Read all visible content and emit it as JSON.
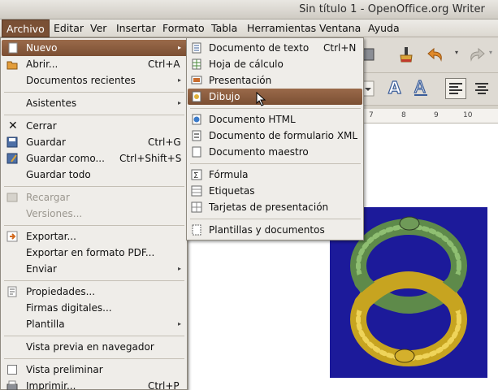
{
  "window": {
    "title": "Sin título 1 - OpenOffice.org Writer"
  },
  "menubar": {
    "items": [
      "Archivo",
      "Editar",
      "Ver",
      "Insertar",
      "Formato",
      "Tabla",
      "Herramientas",
      "Ventana",
      "Ayuda"
    ]
  },
  "archivo_menu": {
    "items": [
      {
        "label": "Nuevo",
        "shortcut": "",
        "submenu": true,
        "icon": "new-document-icon"
      },
      {
        "label": "Abrir...",
        "shortcut": "Ctrl+A",
        "icon": "open-folder-icon"
      },
      {
        "label": "Documentos recientes",
        "shortcut": "",
        "submenu": true
      },
      {
        "label": "Asistentes",
        "shortcut": "",
        "submenu": true
      },
      {
        "label": "Cerrar",
        "shortcut": "",
        "icon": "close-x-icon"
      },
      {
        "label": "Guardar",
        "shortcut": "Ctrl+G",
        "icon": "save-icon"
      },
      {
        "label": "Guardar como...",
        "shortcut": "Ctrl+Shift+S",
        "icon": "save-as-icon"
      },
      {
        "label": "Guardar todo",
        "shortcut": ""
      },
      {
        "label": "Recargar",
        "shortcut": "",
        "disabled": true,
        "icon": "reload-icon"
      },
      {
        "label": "Versiones...",
        "shortcut": "",
        "disabled": true
      },
      {
        "label": "Exportar...",
        "shortcut": "",
        "icon": "export-icon"
      },
      {
        "label": "Exportar en formato PDF...",
        "shortcut": ""
      },
      {
        "label": "Enviar",
        "shortcut": "",
        "submenu": true
      },
      {
        "label": "Propiedades...",
        "shortcut": "",
        "icon": "properties-icon"
      },
      {
        "label": "Firmas digitales...",
        "shortcut": ""
      },
      {
        "label": "Plantilla",
        "shortcut": "",
        "submenu": true
      },
      {
        "label": "Vista previa en navegador",
        "shortcut": ""
      },
      {
        "label": "Vista preliminar",
        "shortcut": "",
        "icon": "checkbox-icon"
      },
      {
        "label": "Imprimir...",
        "shortcut": "Ctrl+P",
        "icon": "print-icon"
      }
    ]
  },
  "nuevo_submenu": {
    "items": [
      {
        "label": "Documento de texto",
        "shortcut": "Ctrl+N",
        "icon": "text-document-icon"
      },
      {
        "label": "Hoja de cálculo",
        "shortcut": "",
        "icon": "spreadsheet-icon"
      },
      {
        "label": "Presentación",
        "shortcut": "",
        "icon": "presentation-icon"
      },
      {
        "label": "Dibujo",
        "shortcut": "",
        "icon": "drawing-icon"
      },
      {
        "label": "Documento HTML",
        "shortcut": "",
        "icon": "html-document-icon"
      },
      {
        "label": "Documento de formulario XML",
        "shortcut": "",
        "icon": "xml-form-icon"
      },
      {
        "label": "Documento maestro",
        "shortcut": "",
        "icon": "master-document-icon"
      },
      {
        "label": "Fórmula",
        "shortcut": "",
        "icon": "formula-icon"
      },
      {
        "label": "Etiquetas",
        "shortcut": "",
        "icon": "labels-icon"
      },
      {
        "label": "Tarjetas de presentación",
        "shortcut": "",
        "icon": "business-cards-icon"
      },
      {
        "label": "Plantillas y documentos",
        "shortcut": "",
        "icon": "templates-icon"
      }
    ]
  },
  "ruler": {
    "ticks": [
      "7",
      "8",
      "9",
      "10"
    ]
  },
  "colors": {
    "highlight": "#7b4f33",
    "menu_bg": "#efede9",
    "doc_image_bg": "#1c1a9a"
  }
}
